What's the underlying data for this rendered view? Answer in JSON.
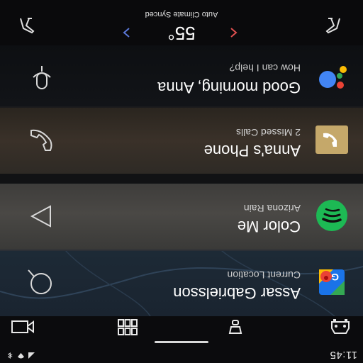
{
  "status": {
    "time": "11:45"
  },
  "cards": {
    "maps": {
      "title": "Assar Gabrielsson",
      "subtitle": "Current Location"
    },
    "music": {
      "title": "Color Me",
      "subtitle": "Arizona Rain"
    },
    "phone": {
      "title": "Anna's Phone",
      "subtitle": "2 Missed Calls"
    },
    "assistant": {
      "title": "Good morning, Anna",
      "subtitle": "How can I help?"
    }
  },
  "climate": {
    "temperature": "55°",
    "status": "Auto Climate Synced"
  },
  "colors": {
    "music_green": "#1DB954",
    "phone_tile": "#c5a86a",
    "climate_left_arrow": "#e05050",
    "climate_right_arrow": "#5b78d8"
  },
  "icons": {
    "nav": [
      "video-icon",
      "grid-icon",
      "notification-icon",
      "car-icon"
    ],
    "status": [
      "signal-icon",
      "wifi-icon",
      "bluetooth-icon"
    ]
  }
}
